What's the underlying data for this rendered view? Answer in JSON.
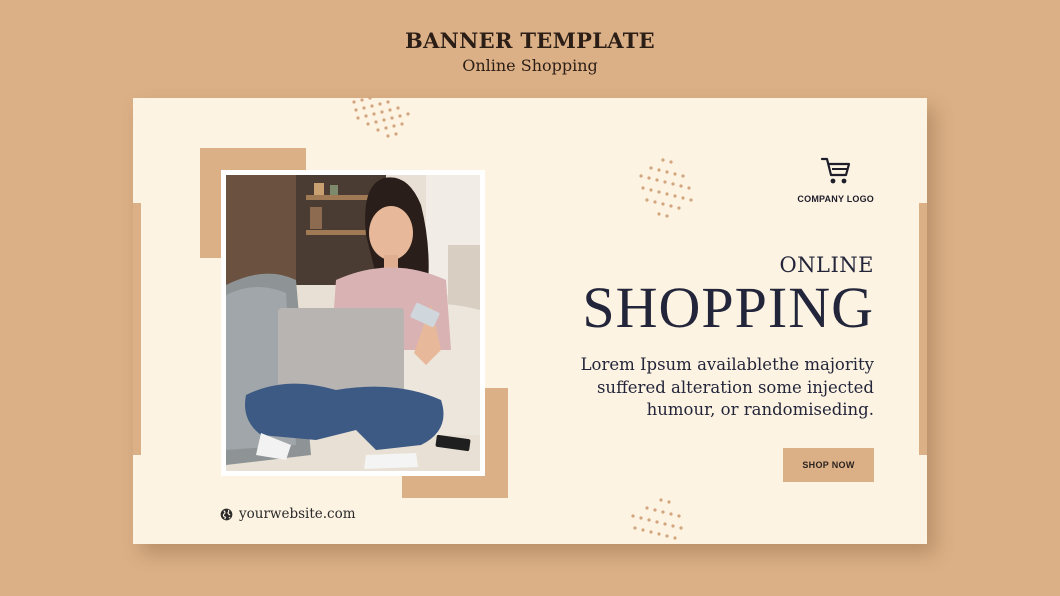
{
  "header": {
    "title": "BANNER TEMPLATE",
    "subtitle": "Online Shopping"
  },
  "banner": {
    "logo": {
      "icon": "shopping-cart-icon",
      "text": "COMPANY LOGO"
    },
    "kicker": "ONLINE",
    "headline": "SHOPPING",
    "body_lines": [
      "Lorem Ipsum availablethe majority",
      "suffered alteration some injected",
      "humour, or randomiseding."
    ],
    "cta_label": "SHOP NOW",
    "website": {
      "icon": "globe-icon",
      "url": "yourwebsite.com"
    },
    "photo": {
      "subject": "woman-with-laptop-and-credit-card-photo"
    }
  },
  "colors": {
    "background": "#dcb086",
    "card": "#fdf3e3",
    "accent": "#dcb086",
    "text_dark": "#23263a"
  }
}
